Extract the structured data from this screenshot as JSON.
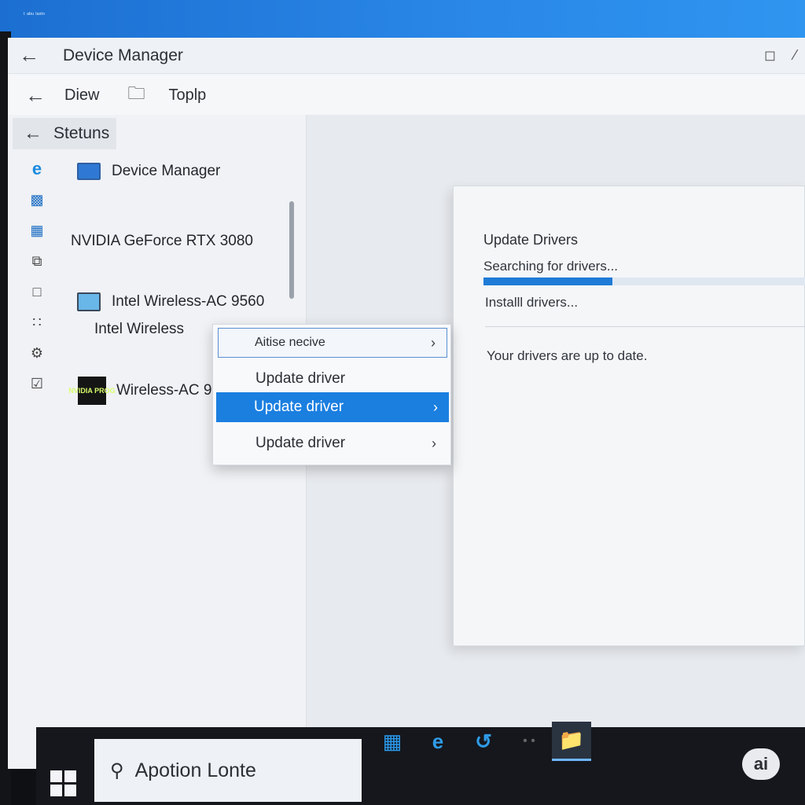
{
  "desktop": {
    "corner_text": "ᵗ ᵃᵇᵘ ˡᵃˢᵗᵒ"
  },
  "window": {
    "title": "Device Manager",
    "toolbar": {
      "item1": "Diew",
      "item2": "Toplp"
    },
    "status_label": "Stetuns"
  },
  "tree": {
    "items": [
      {
        "label": "Device Manager"
      },
      {
        "label": "NVIDIA GeForce RTX 3080"
      },
      {
        "label": "Intel Wireless-AC 9560"
      },
      {
        "label": "Intel Wireless"
      },
      {
        "label": "Wireless-AC 95"
      }
    ],
    "gpu_logo_text": "NVIDIA PROG"
  },
  "context_menu": {
    "items": [
      {
        "label": "Aitise necive"
      },
      {
        "label": "Update driver"
      },
      {
        "label": "Update driver"
      },
      {
        "label": "Update driver"
      }
    ]
  },
  "dialog": {
    "title": "Update Drivers",
    "searching": "Searching for drivers...",
    "progress_fraction": 0.4,
    "installing": "Installl drivers...",
    "status": "Your drivers are up to date."
  },
  "taskbar": {
    "search_text": "Apotion Lonte"
  },
  "badge": {
    "label": "ai"
  },
  "colors": {
    "accent": "#1b7fe0",
    "progress": "#1e7bd6"
  }
}
